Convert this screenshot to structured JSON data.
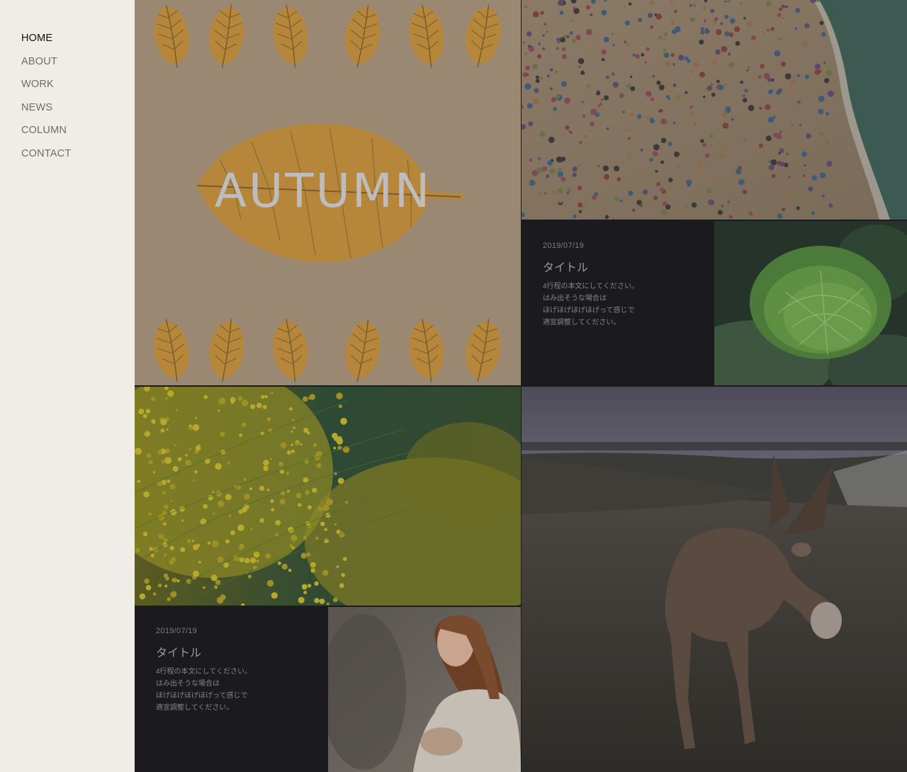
{
  "nav": {
    "items": [
      "HOME",
      "ABOUT",
      "WORK",
      "NEWS",
      "COLUMN",
      "CONTACT"
    ],
    "active_index": 0
  },
  "hero": {
    "text": "AUTUMN"
  },
  "card1": {
    "date": "2019/07/19",
    "title": "タイトル",
    "body": [
      "4行程の本文にしてください。",
      "はみ出そうな場合は",
      "ほげほげほげほげって感じで",
      "適宜調整してください。"
    ]
  },
  "card2": {
    "date": "2019/07/19",
    "title": "タイトル",
    "body": [
      "4行程の本文にしてください。",
      "はみ出そうな場合は",
      "ほげほげほげほげって感じで",
      "適宜調整してください。"
    ]
  },
  "colors": {
    "sidebar_bg": "#f0ece7",
    "card_bg": "#1b1b1f",
    "active_nav": "#111111",
    "nav": "#6f6c69"
  }
}
